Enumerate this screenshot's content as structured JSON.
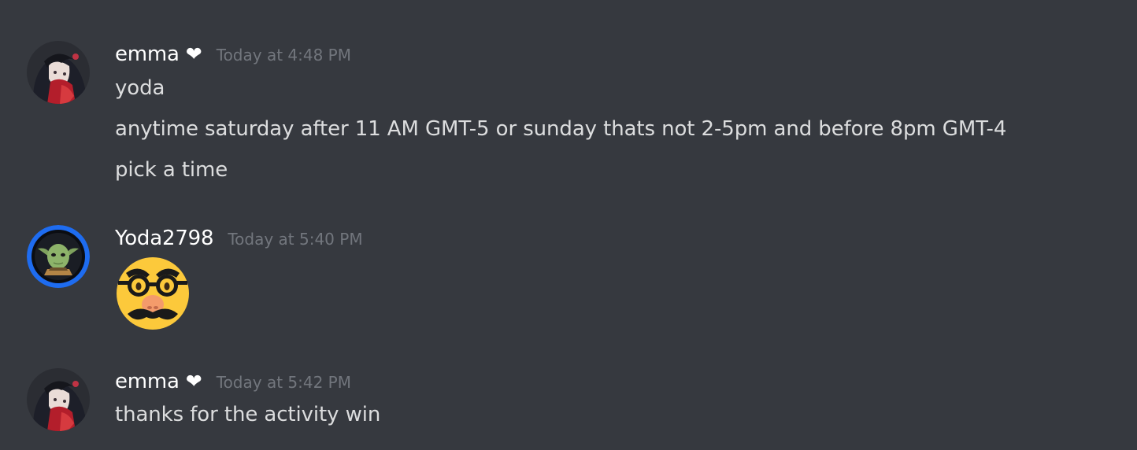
{
  "messages": [
    {
      "username": "emma",
      "heart": "❤",
      "timestamp": "Today at 4:48 PM",
      "lines": [
        "yoda",
        "anytime saturday after 11 AM GMT-5 or sunday thats not 2-5pm and before 8pm GMT-4",
        "pick a time"
      ]
    },
    {
      "username": "Yoda2798",
      "timestamp": "Today at 5:40 PM",
      "emoji_icon": "disguised-face-emoji"
    },
    {
      "username": "emma",
      "heart": "❤",
      "timestamp": "Today at 5:42 PM",
      "lines": [
        "thanks for the activity win"
      ]
    }
  ],
  "colors": {
    "background": "#36393f",
    "username": "#ffffff",
    "message_text": "#dcddde",
    "timestamp": "#72767d",
    "yoda_ring": "#1e6cf0"
  }
}
